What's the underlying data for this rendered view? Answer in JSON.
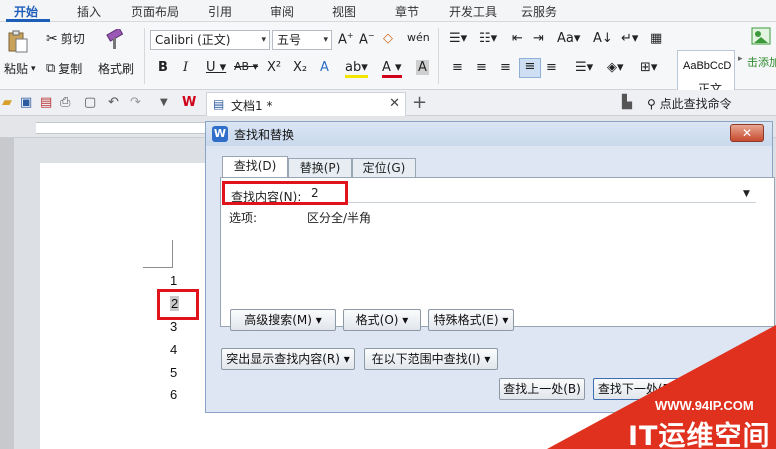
{
  "menu": {
    "tabs": [
      "开始",
      "插入",
      "页面布局",
      "引用",
      "审阅",
      "视图",
      "章节",
      "开发工具",
      "云服务"
    ],
    "active": "开始"
  },
  "ribbon": {
    "paste": "粘贴",
    "cut": "剪切",
    "copy": "复制",
    "format_painter": "格式刷",
    "font_name": "Calibri (正文)",
    "font_size": "五号",
    "style_sample": "AaBbCcD",
    "style_name": "正文",
    "add_style": "击添加"
  },
  "quickbar": {
    "doc_tab": "文档1 *",
    "search_cmd": "点此查找命令"
  },
  "document": {
    "lines": [
      "1",
      "2",
      "3",
      "4",
      "5",
      "6"
    ]
  },
  "dialog": {
    "title": "查找和替换",
    "close": "✕",
    "tabs": [
      "查找(D)",
      "替换(P)",
      "定位(G)"
    ],
    "find_label": "查找内容(N):",
    "find_value": "2",
    "options_label": "选项:",
    "options_value": "区分全/半角",
    "buttons": {
      "advanced": "高级搜索(M) ▾",
      "format": "格式(O) ▾",
      "special": "特殊格式(E) ▾",
      "highlight": "突出显示查找内容(R) ▾",
      "find_in": "在以下范围中查找(I) ▾",
      "prev": "查找上一处(B)",
      "next": "查找下一处(F)"
    }
  },
  "watermark": {
    "url": "WWW.94IP.COM",
    "brand": "IT运维空间"
  },
  "colors": {
    "accent": "#1d5fb8",
    "highlight_red": "#e0131c",
    "watermark_red": "#e0301e"
  }
}
